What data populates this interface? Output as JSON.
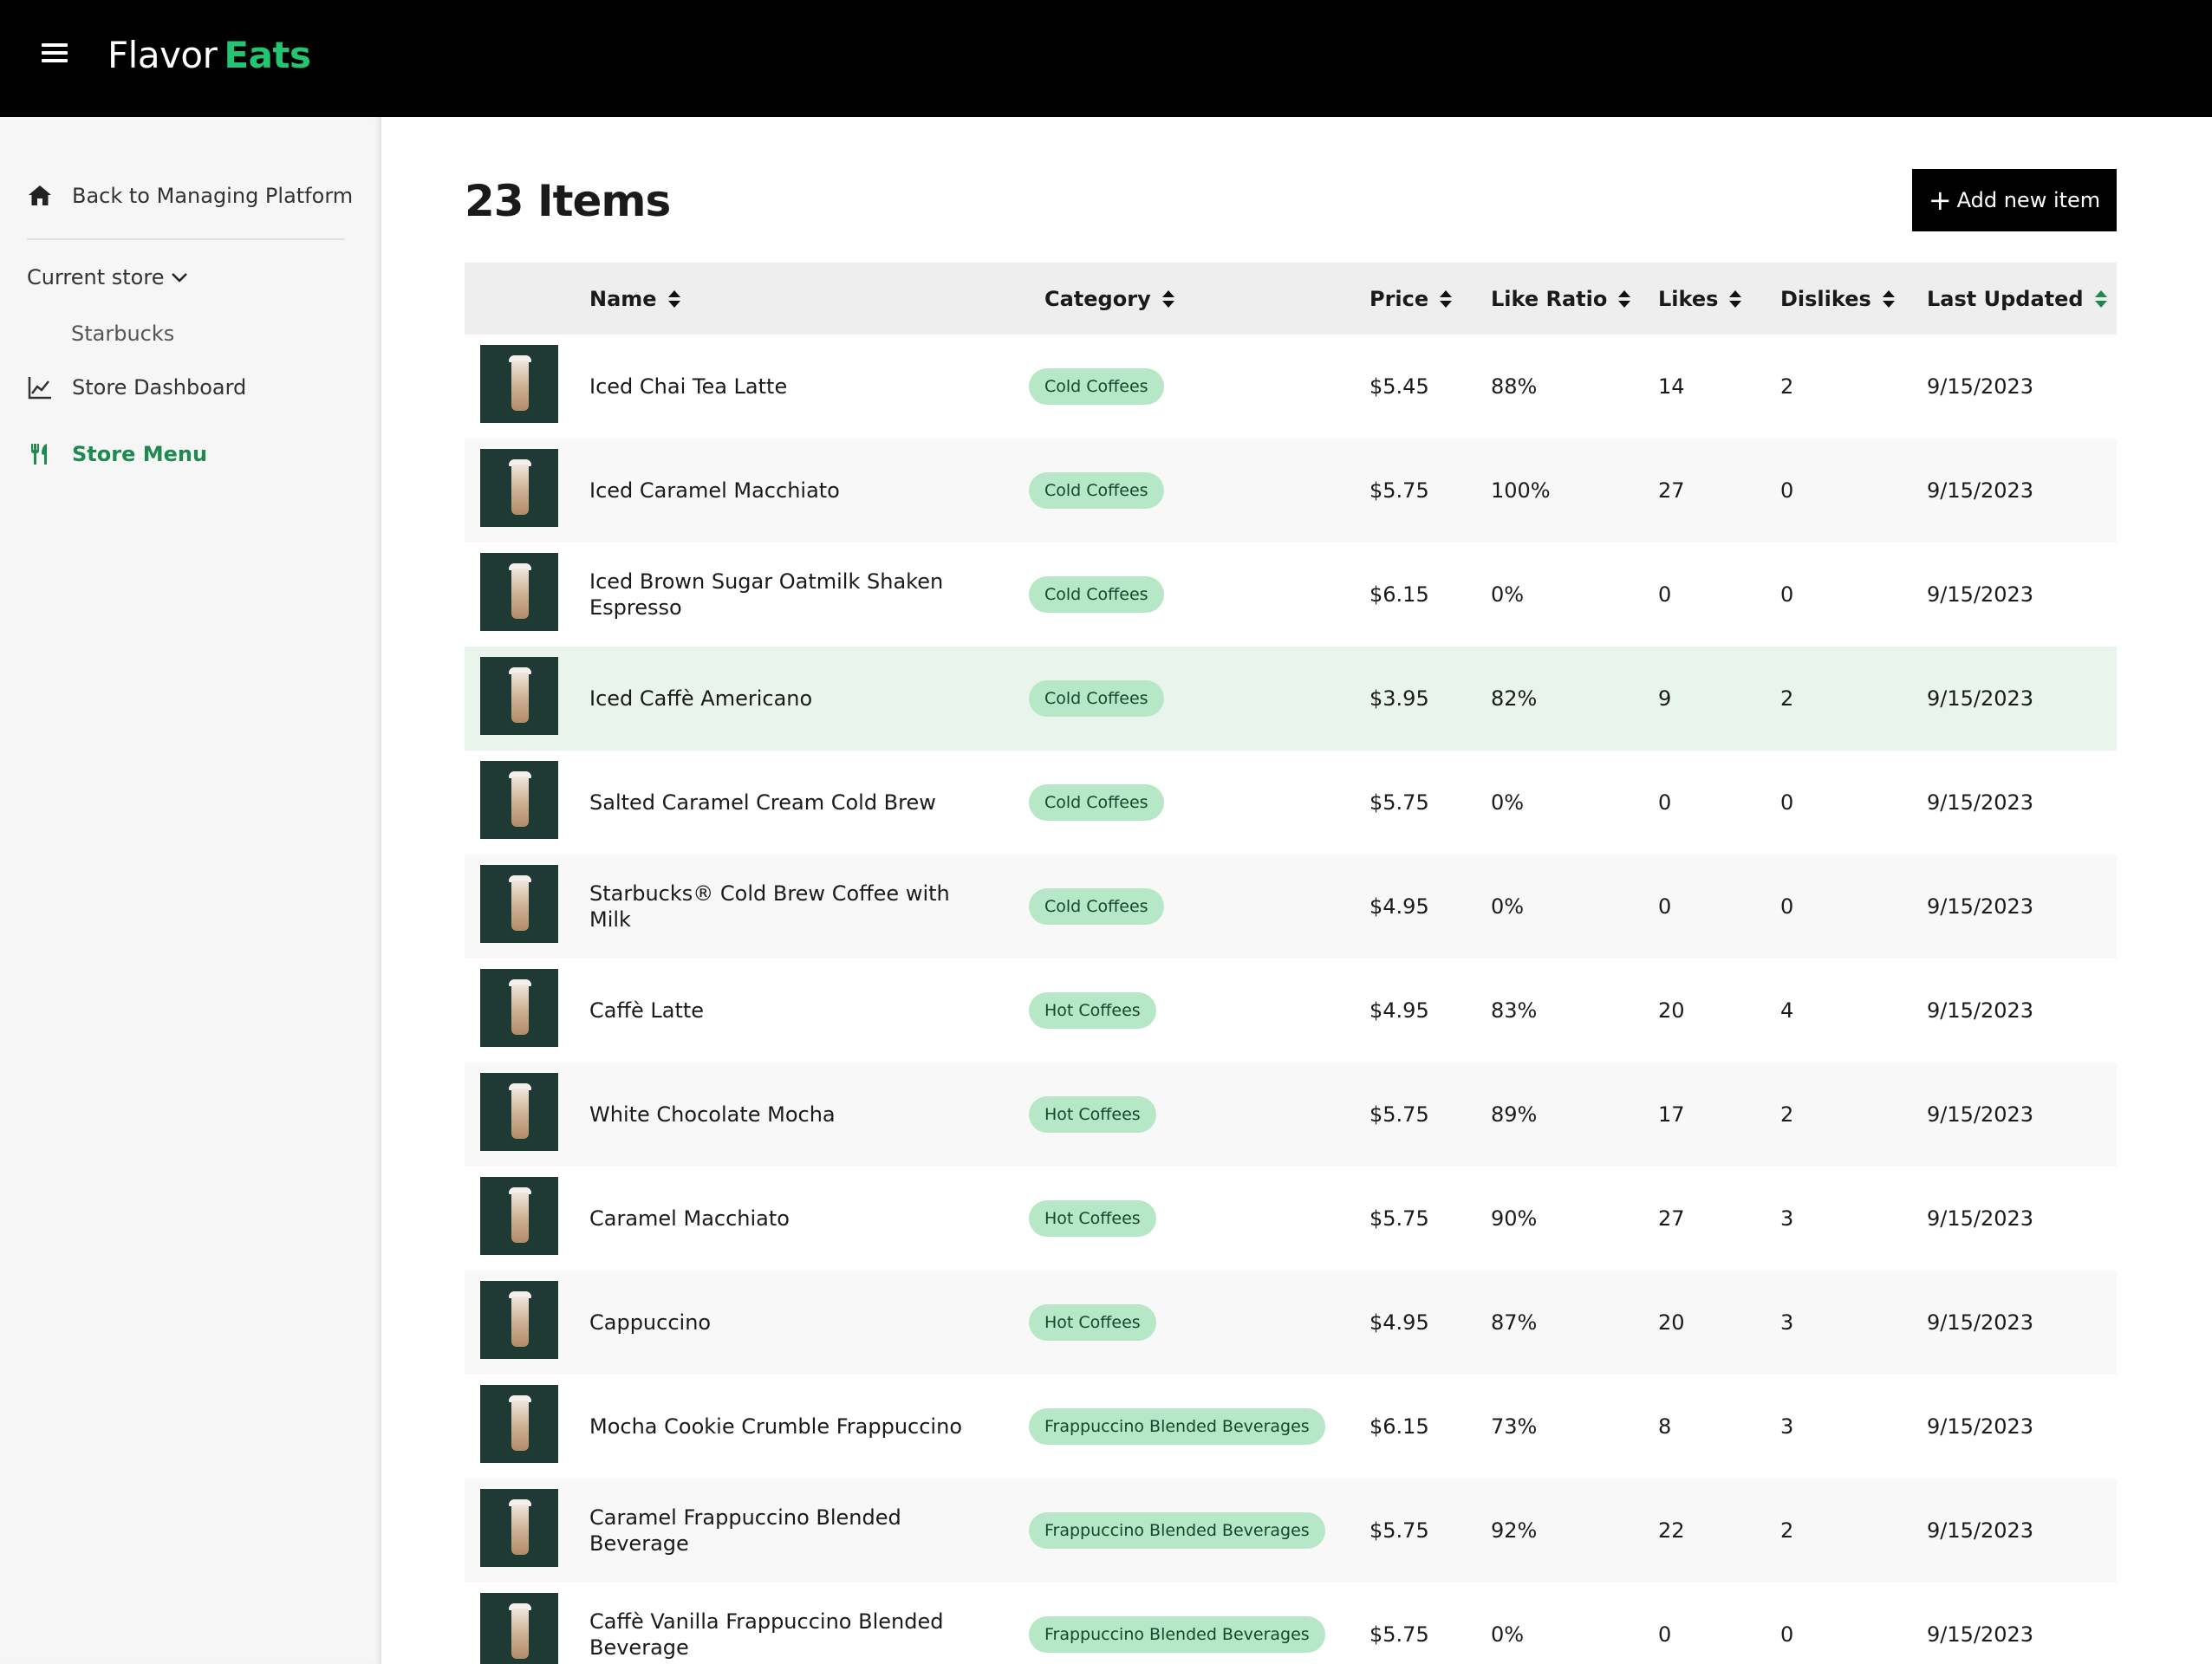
{
  "app": {
    "brand_first": "Flavor",
    "brand_second": "Eats",
    "accent_color": "#25c470"
  },
  "sidebar": {
    "back_label": "Back to Managing Platform",
    "current_store_label": "Current store",
    "store_name": "Starbucks",
    "dashboard_label": "Store Dashboard",
    "menu_label": "Store Menu",
    "active_item": "Store Menu"
  },
  "main": {
    "title": "23 Items",
    "add_button_label": "Add new item",
    "columns": [
      "Name",
      "Category",
      "Price",
      "Like Ratio",
      "Likes",
      "Dislikes",
      "Last Updated"
    ],
    "sorted_column": "Last Updated",
    "rows": [
      {
        "name": "Iced Chai Tea Latte",
        "category": "Cold Coffees",
        "price": "$5.45",
        "ratio": "88%",
        "likes": "14",
        "dislikes": "2",
        "updated": "9/15/2023"
      },
      {
        "name": "Iced Caramel Macchiato",
        "category": "Cold Coffees",
        "price": "$5.75",
        "ratio": "100%",
        "likes": "27",
        "dislikes": "0",
        "updated": "9/15/2023"
      },
      {
        "name": "Iced Brown Sugar Oatmilk Shaken Espresso",
        "category": "Cold Coffees",
        "price": "$6.15",
        "ratio": "0%",
        "likes": "0",
        "dislikes": "0",
        "updated": "9/15/2023"
      },
      {
        "name": "Iced Caffè Americano",
        "category": "Cold Coffees",
        "price": "$3.95",
        "ratio": "82%",
        "likes": "9",
        "dislikes": "2",
        "updated": "9/15/2023"
      },
      {
        "name": "Salted Caramel Cream Cold Brew",
        "category": "Cold Coffees",
        "price": "$5.75",
        "ratio": "0%",
        "likes": "0",
        "dislikes": "0",
        "updated": "9/15/2023"
      },
      {
        "name": "Starbucks® Cold Brew Coffee with Milk",
        "category": "Cold Coffees",
        "price": "$4.95",
        "ratio": "0%",
        "likes": "0",
        "dislikes": "0",
        "updated": "9/15/2023"
      },
      {
        "name": "Caffè Latte",
        "category": "Hot Coffees",
        "price": "$4.95",
        "ratio": "83%",
        "likes": "20",
        "dislikes": "4",
        "updated": "9/15/2023"
      },
      {
        "name": "White Chocolate Mocha",
        "category": "Hot Coffees",
        "price": "$5.75",
        "ratio": "89%",
        "likes": "17",
        "dislikes": "2",
        "updated": "9/15/2023"
      },
      {
        "name": "Caramel Macchiato",
        "category": "Hot Coffees",
        "price": "$5.75",
        "ratio": "90%",
        "likes": "27",
        "dislikes": "3",
        "updated": "9/15/2023"
      },
      {
        "name": "Cappuccino",
        "category": "Hot Coffees",
        "price": "$4.95",
        "ratio": "87%",
        "likes": "20",
        "dislikes": "3",
        "updated": "9/15/2023"
      },
      {
        "name": "Mocha Cookie Crumble Frappuccino",
        "category": "Frappuccino Blended Beverages",
        "price": "$6.15",
        "ratio": "73%",
        "likes": "8",
        "dislikes": "3",
        "updated": "9/15/2023"
      },
      {
        "name": "Caramel Frappuccino Blended Beverage",
        "category": "Frappuccino Blended Beverages",
        "price": "$5.75",
        "ratio": "92%",
        "likes": "22",
        "dislikes": "2",
        "updated": "9/15/2023"
      },
      {
        "name": "Caffè Vanilla Frappuccino Blended Beverage",
        "category": "Frappuccino Blended Beverages",
        "price": "$5.75",
        "ratio": "0%",
        "likes": "0",
        "dislikes": "0",
        "updated": "9/15/2023"
      }
    ]
  }
}
